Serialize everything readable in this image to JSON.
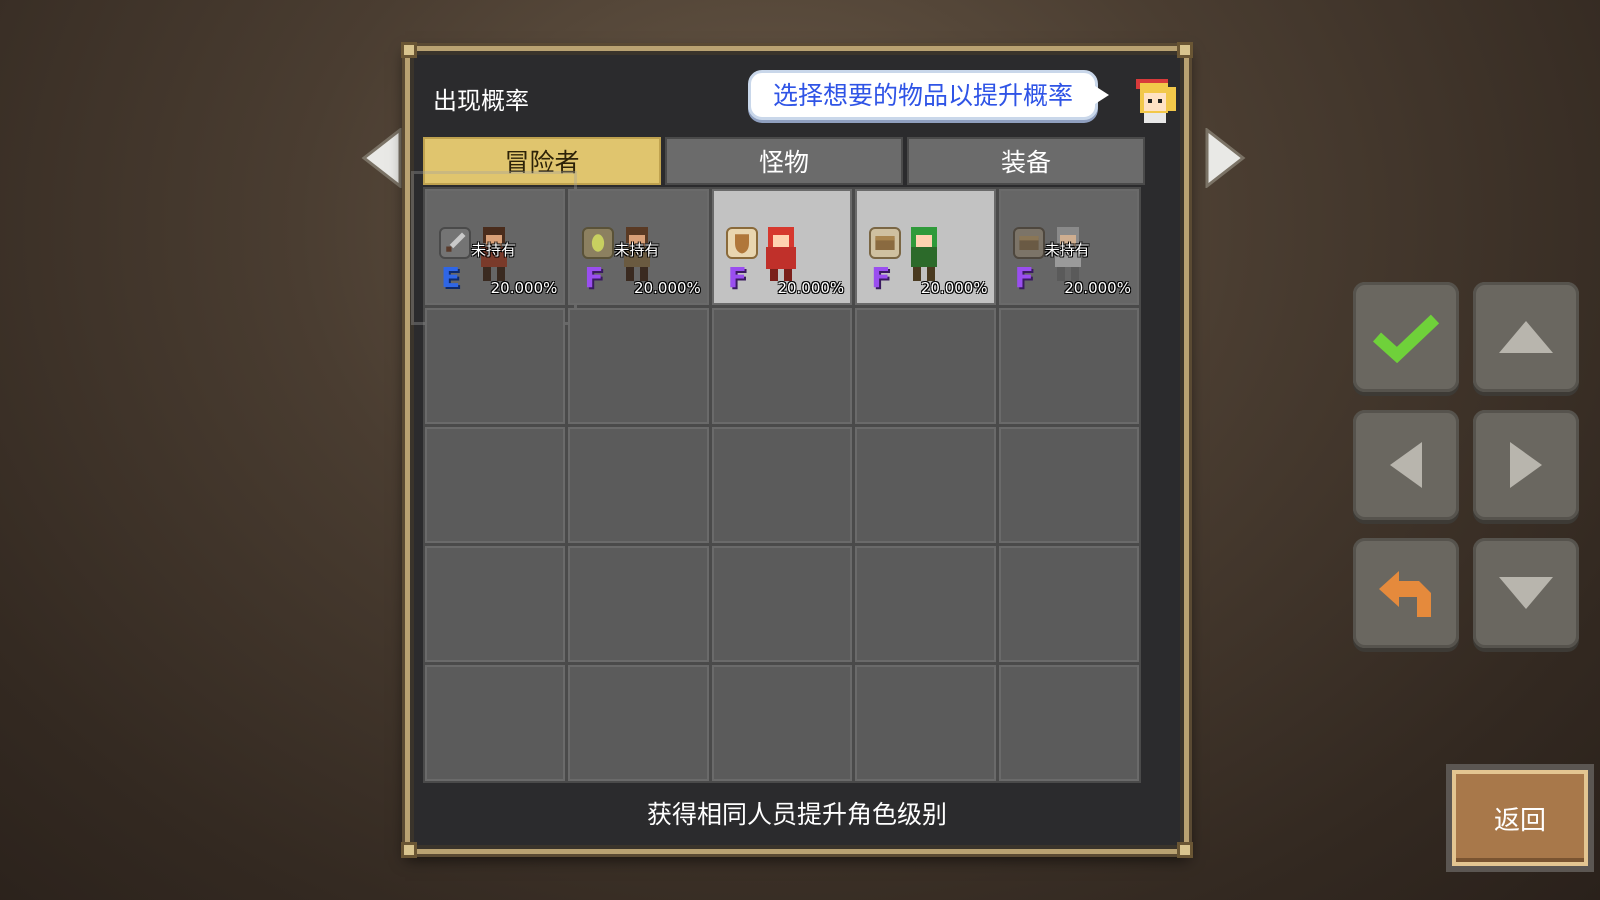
{
  "panel": {
    "title": "出现概率",
    "hint": "选择想要的物品以提升概率",
    "footer": "获得相同人员提升角色级别"
  },
  "tabs": [
    {
      "label": "冒险者",
      "active": true
    },
    {
      "label": "怪物",
      "active": false
    },
    {
      "label": "装备",
      "active": false
    }
  ],
  "items": [
    {
      "rank": "E",
      "status": "未持有",
      "probability": "20.000%",
      "owned": false,
      "gear_icon": "sword-icon",
      "sprite": "brown-adventurer"
    },
    {
      "rank": "F",
      "status": "未持有",
      "probability": "20.000%",
      "owned": false,
      "gear_icon": "gem-icon",
      "sprite": "brown-adventurer"
    },
    {
      "rank": "F",
      "status": "",
      "probability": "20.000%",
      "owned": true,
      "gear_icon": "shield-icon",
      "sprite": "red-hair-adventurer"
    },
    {
      "rank": "F",
      "status": "",
      "probability": "20.000%",
      "owned": true,
      "gear_icon": "chest-icon",
      "sprite": "green-hood-adventurer"
    },
    {
      "rank": "F",
      "status": "未持有",
      "probability": "20.000%",
      "owned": false,
      "gear_icon": "chest-icon",
      "sprite": "armored-adventurer"
    }
  ],
  "controls": {
    "back_label": "返回",
    "buttons": [
      "confirm-check-icon",
      "arrow-up-icon",
      "arrow-left-icon",
      "arrow-right-icon",
      "undo-icon",
      "arrow-down-icon"
    ]
  },
  "colors": {
    "tab_active": "#e0c56e",
    "hint_text": "#2f54e6",
    "rank_f": "#9a4ef0",
    "rank_e": "#2f66e6",
    "confirm": "#6fd13a",
    "undo": "#e58a3c"
  }
}
